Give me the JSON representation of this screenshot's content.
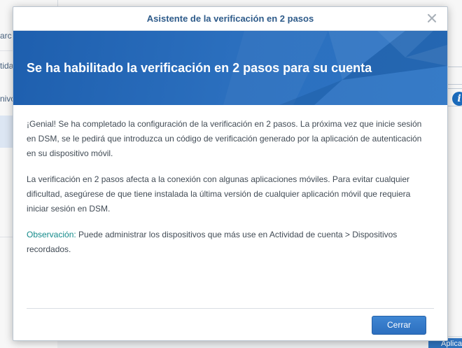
{
  "background": {
    "left_items": [
      "arc",
      "tida",
      "nivo"
    ],
    "apply_button": "Aplica"
  },
  "dialog": {
    "title": "Asistente de la verificación en 2 pasos",
    "banner_heading": "Se ha habilitado la verificación en 2 pasos para su cuenta",
    "paragraph_1": "¡Genial! Se ha completado la configuración de la verificación en 2 pasos. La próxima vez que inicie sesión en DSM, se le pedirá que introduzca un código de verificación generado por la aplicación de autenticación en su dispositivo móvil.",
    "paragraph_2": "La verificación en 2 pasos afecta a la conexión con algunas aplicaciones móviles. Para evitar cualquier dificultad, asegúrese de que tiene instalada la última versión de cualquier aplicación móvil que requiera iniciar sesión en DSM.",
    "note_label": "Observación:",
    "note_text": " Puede administrar los dispositivos que más use en Actividad de cuenta > Dispositivos recordados.",
    "close_button": "Cerrar"
  },
  "icons": {
    "close": "close-icon",
    "info": "info-icon"
  },
  "colors": {
    "banner": "#2b6fbe",
    "title": "#2e5b8a",
    "note": "#138a8a",
    "primary_button": "#3577c8"
  }
}
